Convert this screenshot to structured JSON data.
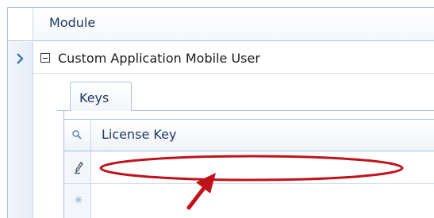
{
  "grid": {
    "header": {
      "column_label": "Module"
    },
    "row": {
      "label": "Custom Application Mobile User",
      "expanded": true
    }
  },
  "detail": {
    "tabs": [
      {
        "label": "Keys",
        "selected": true
      }
    ],
    "columns": [
      {
        "label": "License Key"
      }
    ],
    "rows": [
      {
        "license_key": "",
        "editing": true
      }
    ]
  },
  "icons": {
    "row_indicator": "chevron-right-icon",
    "expand": "collapse-minus-icon",
    "filter": "magnifier-icon",
    "edit": "pencil-icon",
    "new_row": "asterisk-icon"
  },
  "colors": {
    "annotation": "#c0121b",
    "grid_border": "#a9bfd6",
    "header_text": "#1d3b63"
  }
}
